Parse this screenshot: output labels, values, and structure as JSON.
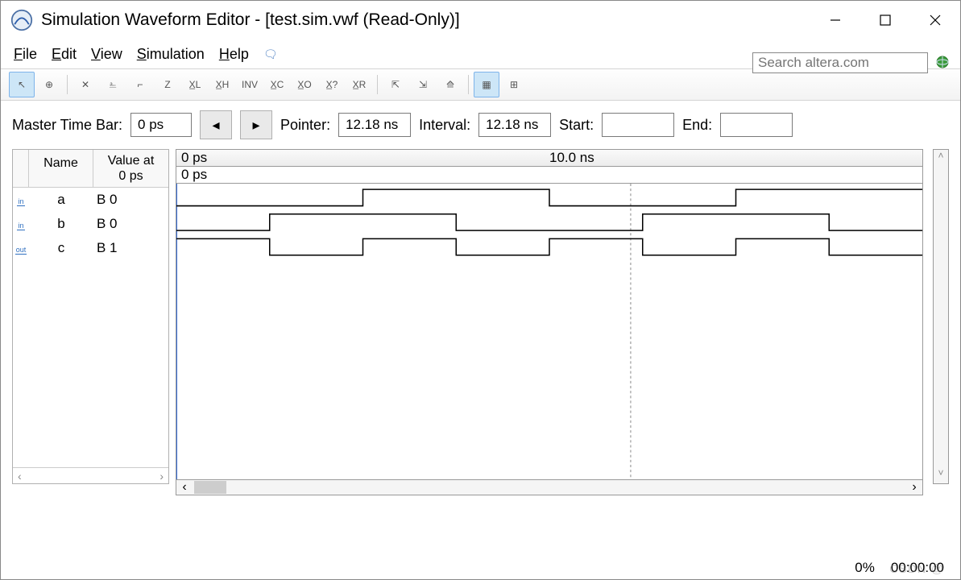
{
  "window": {
    "title": "Simulation Waveform Editor - [test.sim.vwf (Read-Only)]"
  },
  "menu": {
    "file": "File",
    "edit": "Edit",
    "view": "View",
    "simulation": "Simulation",
    "help": "Help"
  },
  "search": {
    "placeholder": "Search altera.com"
  },
  "toolbar": {
    "items": [
      {
        "name": "pointer-tool",
        "glyph": "↖",
        "active": true
      },
      {
        "name": "zoom-tool",
        "glyph": "⊕"
      },
      {
        "name": "sep"
      },
      {
        "name": "xx-tool",
        "glyph": "✕"
      },
      {
        "name": "low-tool",
        "glyph": "⎁"
      },
      {
        "name": "high-tool",
        "glyph": "⌐"
      },
      {
        "name": "z-tool",
        "glyph": "Z"
      },
      {
        "name": "xl-tool",
        "glyph": "X̲L"
      },
      {
        "name": "xh-tool",
        "glyph": "X̲H"
      },
      {
        "name": "inv-tool",
        "glyph": "INV"
      },
      {
        "name": "xc-tool",
        "glyph": "X̲C"
      },
      {
        "name": "xo-tool",
        "glyph": "X̲O"
      },
      {
        "name": "xq-tool",
        "glyph": "X̲?"
      },
      {
        "name": "xr-tool",
        "glyph": "X̲R"
      },
      {
        "name": "sep"
      },
      {
        "name": "group-1",
        "glyph": "⇱"
      },
      {
        "name": "group-2",
        "glyph": "⇲"
      },
      {
        "name": "group-3",
        "glyph": "⟰"
      },
      {
        "name": "sep"
      },
      {
        "name": "grid-tool",
        "glyph": "▦",
        "active": true
      },
      {
        "name": "snaps-tool",
        "glyph": "⊞"
      }
    ]
  },
  "timerow": {
    "master_label": "Master Time Bar:",
    "master_value": "0 ps",
    "pointer_label": "Pointer:",
    "pointer_value": "12.18 ns",
    "interval_label": "Interval:",
    "interval_value": "12.18 ns",
    "start_label": "Start:",
    "start_value": "",
    "end_label": "End:",
    "end_value": ""
  },
  "signal_table": {
    "headers": {
      "name": "Name",
      "value": "Value at\n0 ps"
    },
    "rows": [
      {
        "dir": "in",
        "name": "a",
        "value": "B 0"
      },
      {
        "dir": "in",
        "name": "b",
        "value": "B 0"
      },
      {
        "dir": "out",
        "name": "c",
        "value": "B 1"
      }
    ]
  },
  "ruler": {
    "origin": "0 ps",
    "mark1": "10.0 ns",
    "sub": "0 ps"
  },
  "status": {
    "percent": "0%",
    "time": "00:00:00"
  },
  "chart_data": {
    "type": "digital-waveform",
    "time_unit": "ns",
    "x_range": [
      0,
      20
    ],
    "master_time_bar_ps": 0,
    "signals": [
      {
        "name": "a",
        "direction": "in",
        "transitions_ns": [
          0,
          5,
          10,
          15
        ],
        "initial": 0,
        "value_at_0ps": "B 0"
      },
      {
        "name": "b",
        "direction": "in",
        "transitions_ns": [
          0,
          2.5,
          7.5,
          12.5,
          17.5
        ],
        "initial": 0,
        "value_at_0ps": "B 0"
      },
      {
        "name": "c",
        "direction": "out",
        "transitions_ns": [
          0,
          2.5,
          5,
          7.5,
          10,
          12.5,
          15,
          17.5
        ],
        "initial": 1,
        "value_at_0ps": "B 1"
      }
    ],
    "ruler_ticks_ns": [
      0,
      10
    ],
    "pointer_ns": 12.18
  }
}
